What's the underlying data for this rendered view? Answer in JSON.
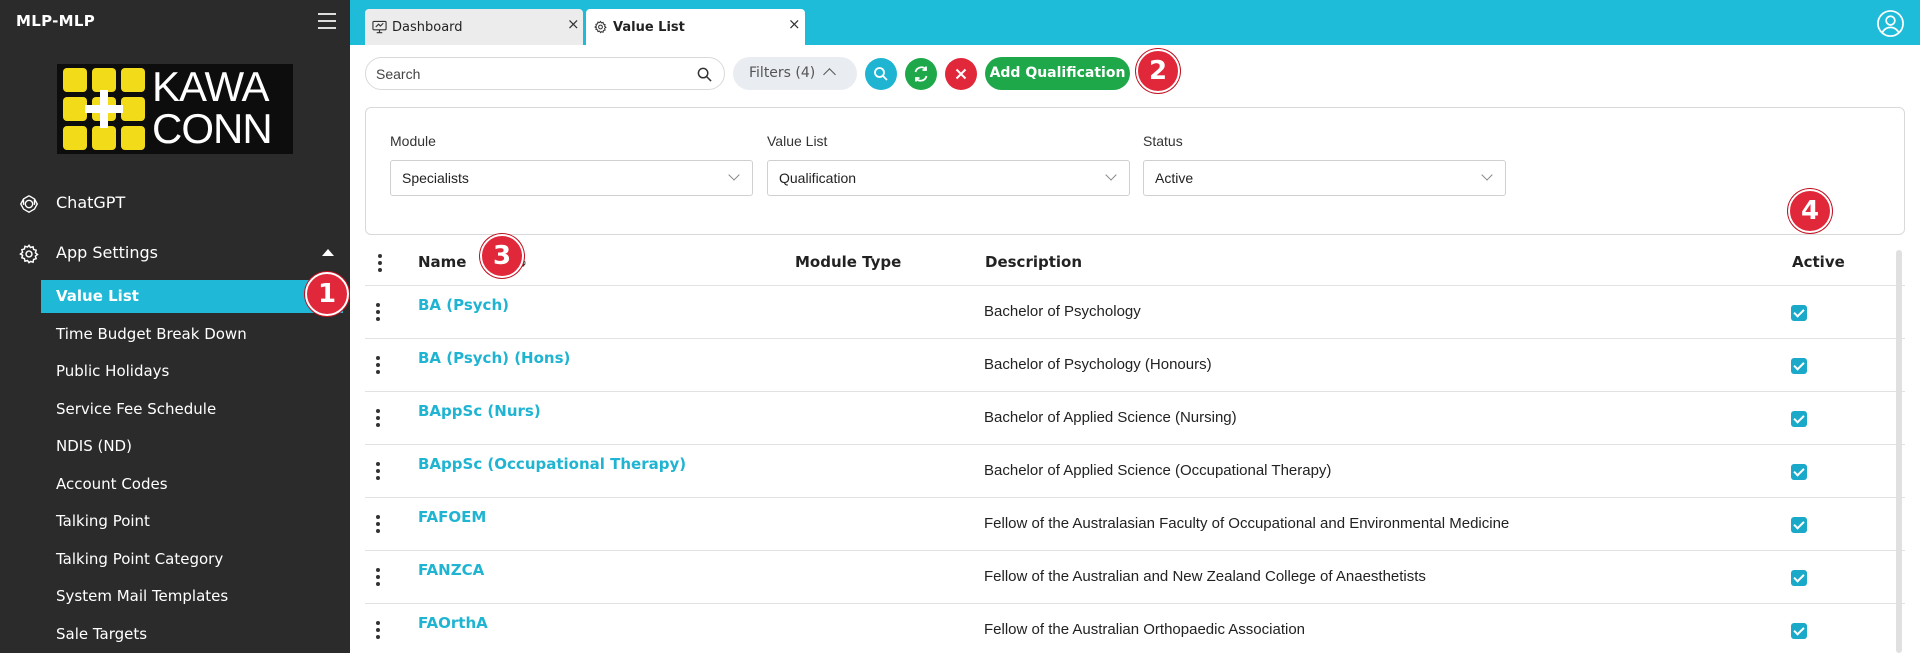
{
  "app": {
    "title": "MLP-MLP"
  },
  "logo": {
    "line1": "KAWA",
    "line2": "CONN"
  },
  "sidebar": {
    "items": [
      {
        "label": "ChatGPT",
        "icon": "openai-icon"
      },
      {
        "label": "App Settings",
        "icon": "gear-icon",
        "expanded": true
      }
    ],
    "subitems": [
      {
        "label": "Value List",
        "active": true
      },
      {
        "label": "Time Budget Break Down"
      },
      {
        "label": "Public Holidays"
      },
      {
        "label": "Service Fee Schedule"
      },
      {
        "label": "NDIS (ND)"
      },
      {
        "label": "Account Codes"
      },
      {
        "label": "Talking Point"
      },
      {
        "label": "Talking Point Category"
      },
      {
        "label": "System Mail Templates"
      },
      {
        "label": "Sale Targets"
      }
    ]
  },
  "tabs": [
    {
      "label": "Dashboard",
      "icon": "dashboard-icon",
      "close": "×"
    },
    {
      "label": "Value List",
      "icon": "gear-icon",
      "close": "×",
      "active": true
    }
  ],
  "toolbar": {
    "search_placeholder": "Search",
    "filters_label": "Filters (4)",
    "add_label": "Add Qualification"
  },
  "filters": [
    {
      "label": "Module",
      "value": "Specialists"
    },
    {
      "label": "Value List",
      "value": "Qualification"
    },
    {
      "label": "Status",
      "value": "Active"
    }
  ],
  "table": {
    "columns": {
      "name": "Name",
      "module_type": "Module Type",
      "description": "Description",
      "active": "Active"
    },
    "rows": [
      {
        "name": "BA (Psych)",
        "module_type": "",
        "description": "Bachelor of Psychology",
        "active": true
      },
      {
        "name": "BA (Psych) (Hons)",
        "module_type": "",
        "description": "Bachelor of Psychology (Honours)",
        "active": true
      },
      {
        "name": "BAppSc (Nurs)",
        "module_type": "",
        "description": "Bachelor of Applied Science (Nursing)",
        "active": true
      },
      {
        "name": "BAppSc (Occupational Therapy)",
        "module_type": "",
        "description": "Bachelor of Applied Science (Occupational Therapy)",
        "active": true
      },
      {
        "name": "FAFOEM",
        "module_type": "",
        "description": "Fellow of the Australasian Faculty of Occupational and Environmental Medicine",
        "active": true
      },
      {
        "name": "FANZCA",
        "module_type": "",
        "description": "Fellow of the Australian and New Zealand College of Anaesthetists",
        "active": true
      },
      {
        "name": "FAOrthA",
        "module_type": "",
        "description": "Fellow of the Australian Orthopaedic Association",
        "active": true
      }
    ]
  },
  "badges": [
    "1",
    "2",
    "3",
    "4"
  ],
  "colors": {
    "accent": "#1fbcd9",
    "sidebar": "#2b2b2b",
    "add_button": "#1ea84a",
    "clear_button": "#e0283a",
    "badge": "#e0283a",
    "logo_yellow": "#f2dc1a"
  }
}
